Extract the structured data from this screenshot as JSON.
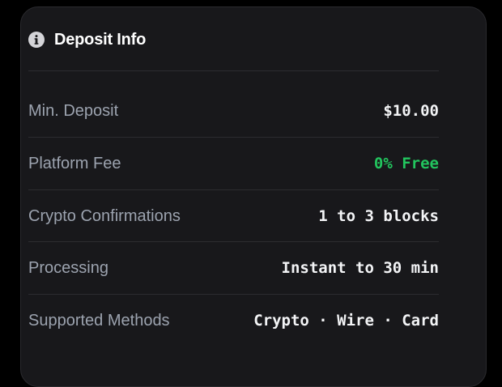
{
  "card": {
    "title": "Deposit Info",
    "icon": "info-icon",
    "rows": [
      {
        "label": "Min. Deposit",
        "value": "$10.00"
      },
      {
        "label": "Platform Fee",
        "value": "0% Free",
        "value_color": "#22c55e"
      },
      {
        "label": "Crypto Confirmations",
        "value": "1 to 3 blocks"
      },
      {
        "label": "Processing",
        "value": "Instant to 30 min"
      },
      {
        "label": "Supported Methods",
        "value": "Crypto · Wire · Card"
      }
    ]
  },
  "colors": {
    "background": "#000000",
    "card": "#18181b",
    "label": "#9ca3af",
    "value": "#f3f4f6",
    "accent_green": "#22c55e"
  }
}
